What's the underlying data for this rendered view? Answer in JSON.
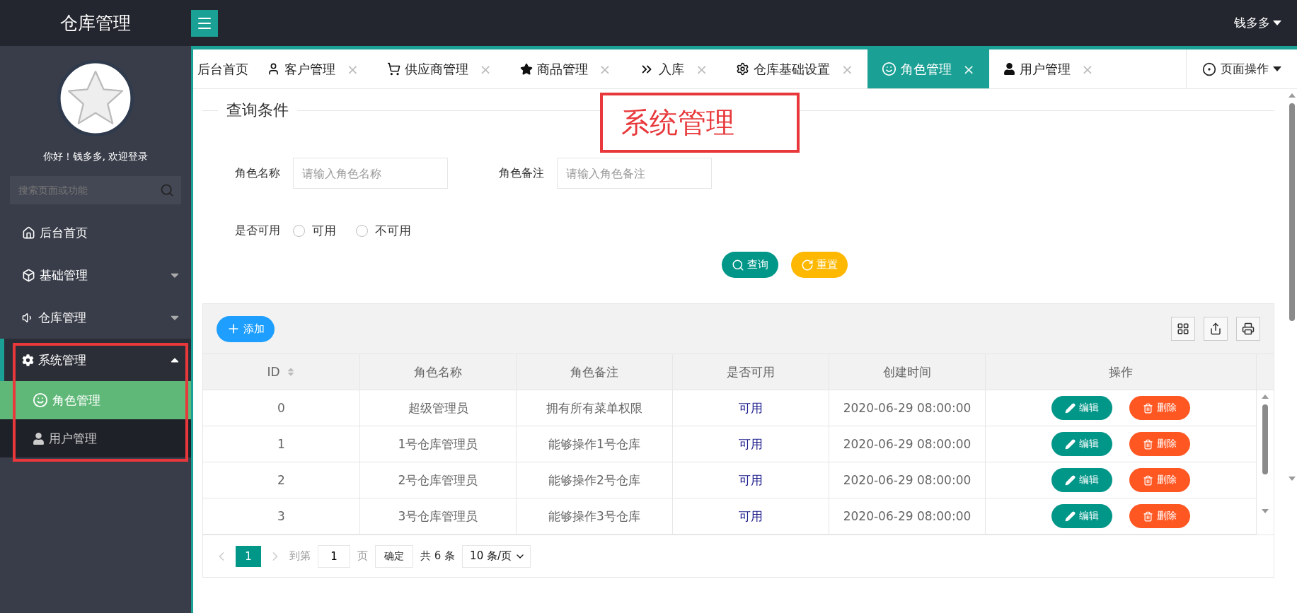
{
  "app_title": "仓库管理",
  "user": "钱多多",
  "sidebar": {
    "greeting": "你好！钱多多, 欢迎登录",
    "search_placeholder": "搜索页面或功能",
    "items": [
      {
        "label": "后台首页",
        "kind": "link"
      },
      {
        "label": "基础管理",
        "kind": "group",
        "expanded": false,
        "annotated": false
      },
      {
        "label": "仓库管理",
        "kind": "group",
        "expanded": false,
        "annotated": false
      },
      {
        "label": "系统管理",
        "kind": "group",
        "expanded": true,
        "annotated": true,
        "children": [
          {
            "label": "角色管理",
            "selected": true
          },
          {
            "label": "用户管理",
            "selected": false
          }
        ]
      }
    ]
  },
  "tabs": [
    {
      "label": "后台首页",
      "selected": false
    },
    {
      "label": "客户管理",
      "close": "×",
      "selected": false
    },
    {
      "label": "供应商管理",
      "close": "×",
      "selected": false
    },
    {
      "label": "商品管理",
      "close": "×",
      "selected": false
    },
    {
      "label": "入库",
      "close": "×",
      "selected": false
    },
    {
      "label": "仓库基础设置",
      "close": "×",
      "selected": false
    },
    {
      "label": "角色管理",
      "close": "×",
      "selected": true
    },
    {
      "label": "用户管理",
      "close": "×",
      "selected": false
    }
  ],
  "page_ops": "页面操作",
  "annotation": {
    "label": "系统管理"
  },
  "query": {
    "legend": "查询条件",
    "fields": [
      {
        "label": "角色名称",
        "placeholder": "请输入角色名称"
      },
      {
        "label": "角色备注",
        "placeholder": "请输入角色备注"
      }
    ],
    "radio_label": "是否可用",
    "radios": [
      {
        "label": "可用",
        "selected": false
      },
      {
        "label": "不可用",
        "selected": false
      }
    ],
    "buttons": [
      {
        "label": "查询",
        "kind": "search"
      },
      {
        "label": "重置",
        "kind": "reset"
      }
    ]
  },
  "table": {
    "add_button": "添加",
    "columns": [
      "ID",
      "角色名称",
      "角色备注",
      "是否可用",
      "创建时间",
      "操作"
    ],
    "rows": [
      {
        "cells": [
          "0",
          "超级管理员",
          "拥有所有菜单权限",
          "可用",
          "2020-06-29 08:00:00"
        ],
        "actions": [
          "编辑",
          "删除"
        ]
      },
      {
        "cells": [
          "1",
          "1号仓库管理员",
          "能够操作1号仓库",
          "可用",
          "2020-06-29 08:00:00"
        ],
        "actions": [
          "编辑",
          "删除"
        ]
      },
      {
        "cells": [
          "2",
          "2号仓库管理员",
          "能够操作2号仓库",
          "可用",
          "2020-06-29 08:00:00"
        ],
        "actions": [
          "编辑",
          "删除"
        ]
      },
      {
        "cells": [
          "3",
          "3号仓库管理员",
          "能够操作3号仓库",
          "可用",
          "2020-06-29 08:00:00"
        ],
        "actions": [
          "编辑",
          "删除"
        ]
      }
    ]
  },
  "pagination": {
    "current": "1",
    "goto_label": "到第",
    "page_input": "1",
    "page_unit": "页",
    "confirm": "确定",
    "total": "共 6 条",
    "page_size": "10 条/页"
  }
}
